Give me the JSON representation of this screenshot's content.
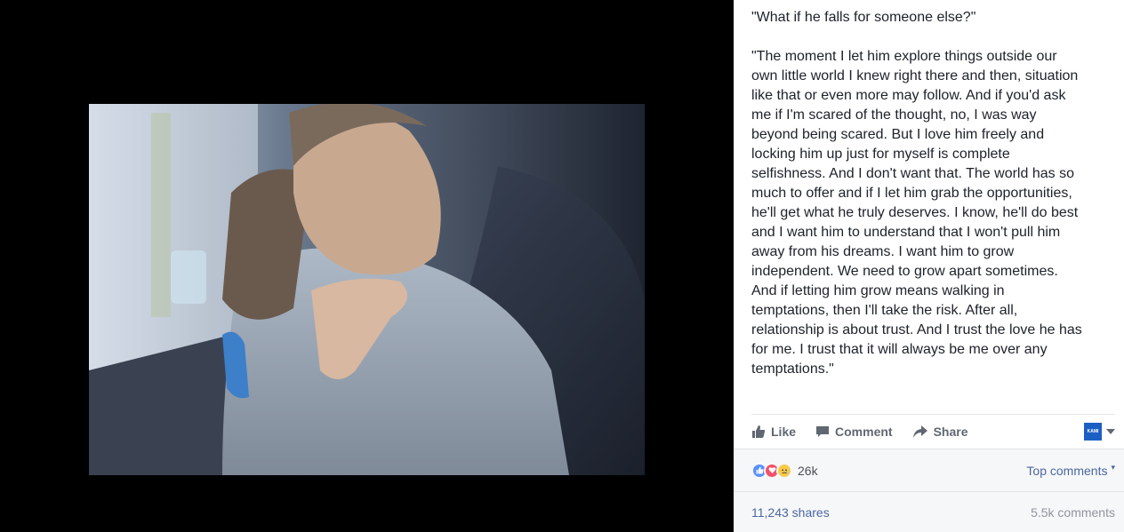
{
  "photo": {
    "alt_description": ""
  },
  "post": {
    "headline": "\"What if he falls for someone else?\"",
    "body": "\"The moment I let him explore things outside our\nown little world I knew right there and then, situation\nlike that or even more may follow. And if you'd ask\nme if I'm scared of the thought, no, I was way\nbeyond being scared. But I love him freely and\nlocking him up just for myself is complete\nselfishness. And I don't want that. The world has so\nmuch to offer and if I let him grab the opportunities,\nhe'll get what he truly deserves. I know, he'll do best\nand I want him to understand that I won't pull him\naway from his dreams. I want him to grow\nindependent. We need to grow apart sometimes.\nAnd if letting him grow means walking in\ntemptations, then I'll take the risk. After all,\nrelationship is about trust. And I trust the love he has\nfor me. I trust that it will always be me over any\ntemptations.\""
  },
  "actions": {
    "like": "Like",
    "comment": "Comment",
    "share": "Share",
    "page_avatar_text": "KAMI"
  },
  "reactions": {
    "icons": [
      "like-icon",
      "love-icon",
      "sad-icon"
    ],
    "count": "26k",
    "sort_label": "Top comments",
    "sort_caret": "▾"
  },
  "stats": {
    "shares": "11,243 shares",
    "comments": "5.5k comments"
  },
  "colors": {
    "link_blue": "#4b67a1",
    "like_blue": "#5890ff",
    "love_red": "#f25268",
    "sad_yellow": "#f7c94b"
  }
}
